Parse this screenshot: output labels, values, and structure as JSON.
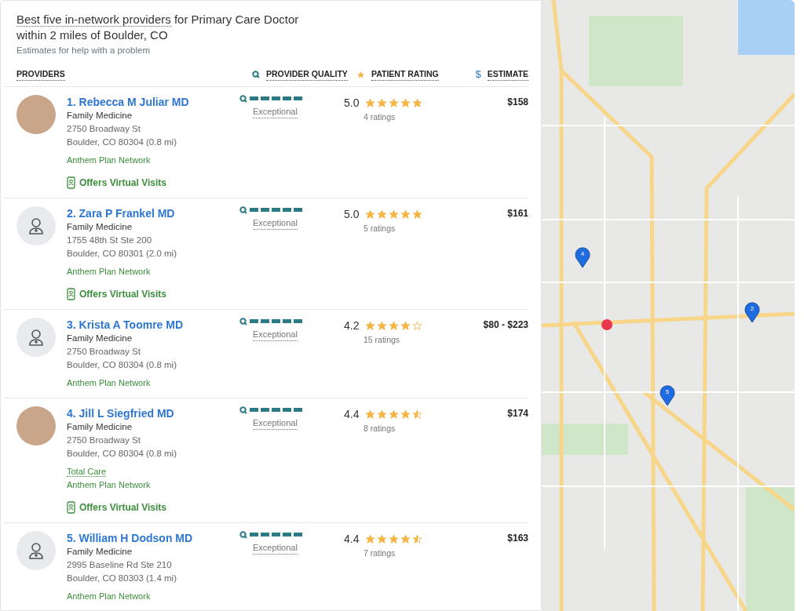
{
  "heading": {
    "emphasis": "Best five in-network providers",
    "rest": "for Primary Care Doctor within 2 miles of Boulder, CO",
    "subtitle": "Estimates for help with a problem"
  },
  "columns": [
    {
      "kind": "providers",
      "label": "PROVIDERS"
    },
    {
      "kind": "quality",
      "label": "PROVIDER QUALITY"
    },
    {
      "kind": "rating",
      "label": "PATIENT RATING"
    },
    {
      "kind": "estimate",
      "icon": "$",
      "label": "ESTIMATE"
    }
  ],
  "providers": [
    {
      "name": "1. Rebecca M Juliar MD",
      "photo": true,
      "specialty": "Family Medicine",
      "address": [
        "2750 Broadway St",
        "Boulder, CO 80304 (0.8 mi)"
      ],
      "network": "Anthem Plan Network",
      "virtual": "Offers Virtual Visits",
      "level": 1,
      "quality": "Exceptional",
      "score": "5.0",
      "stars": 5,
      "ratings": "4 ratings",
      "estimate": "$158"
    },
    {
      "name": "2. Zara P Frankel MD",
      "photo": false,
      "specialty": "Family Medicine",
      "address": [
        "1755 48th St Ste 200",
        "Boulder, CO 80301 (2.0 mi)"
      ],
      "network": "Anthem Plan Network",
      "virtual": "Offers Virtual Visits",
      "level": 1,
      "quality": "Exceptional",
      "score": "5.0",
      "stars": 5,
      "ratings": "5 ratings",
      "estimate": "$161"
    },
    {
      "name": "3. Krista A Toomre MD",
      "photo": false,
      "specialty": "Family Medicine",
      "address": [
        "2750 Broadway St",
        "Boulder, CO 80304 (0.8 mi)"
      ],
      "network": "Anthem Plan Network",
      "level": 1,
      "quality": "Exceptional",
      "score": "4.2",
      "stars": 4,
      "ratings": "15 ratings",
      "estimate": "$80 - $223"
    },
    {
      "name": "4. Jill L Siegfried MD",
      "photo": true,
      "specialty": "Family Medicine",
      "address": [
        "2750 Broadway St",
        "Boulder, CO 80304 (0.8 mi)"
      ],
      "programs": [
        "Total Care"
      ],
      "network": "Anthem Plan Network",
      "virtual": "Offers Virtual Visits",
      "level": 1,
      "quality": "Exceptional",
      "score": "4.4",
      "stars": 4.5,
      "ratings": "8 ratings",
      "estimate": "$174"
    },
    {
      "name": "5. William H Dodson MD",
      "photo": false,
      "specialty": "Family Medicine",
      "address": [
        "2995 Baseline Rd Ste 210",
        "Boulder, CO 80303 (1.4 mi)"
      ],
      "network": "Anthem Plan Network",
      "level": 1,
      "quality": "Exceptional",
      "score": "4.4",
      "stars": 4.5,
      "ratings": "7 ratings",
      "estimate": "$163"
    }
  ],
  "map": {
    "pins": [
      {
        "label": "4"
      },
      {
        "label": "2"
      },
      {
        "label": "5"
      }
    ]
  }
}
